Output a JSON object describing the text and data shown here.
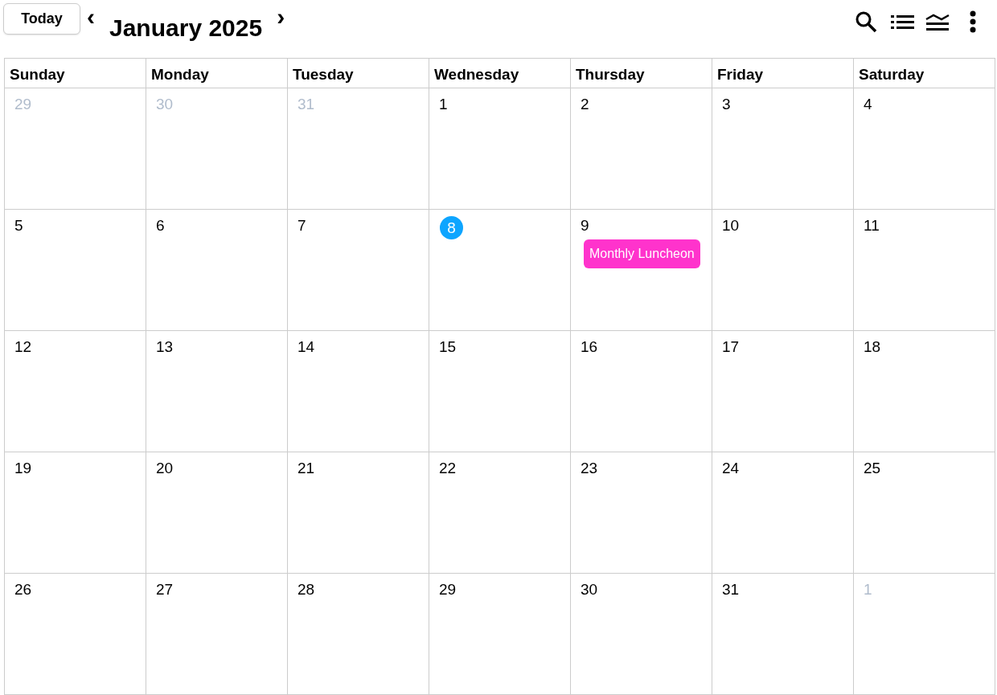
{
  "toolbar": {
    "today_button": "Today",
    "prev": "‹",
    "title": "January 2025",
    "next": "›"
  },
  "weekdays": [
    "Sunday",
    "Monday",
    "Tuesday",
    "Wednesday",
    "Thursday",
    "Friday",
    "Saturday"
  ],
  "weeks": [
    [
      {
        "day": "29",
        "outside": true,
        "today": false
      },
      {
        "day": "30",
        "outside": true,
        "today": false
      },
      {
        "day": "31",
        "outside": true,
        "today": false
      },
      {
        "day": "1",
        "outside": false,
        "today": false
      },
      {
        "day": "2",
        "outside": false,
        "today": false
      },
      {
        "day": "3",
        "outside": false,
        "today": false
      },
      {
        "day": "4",
        "outside": false,
        "today": false
      }
    ],
    [
      {
        "day": "5",
        "outside": false,
        "today": false
      },
      {
        "day": "6",
        "outside": false,
        "today": false
      },
      {
        "day": "7",
        "outside": false,
        "today": false
      },
      {
        "day": "8",
        "outside": false,
        "today": true
      },
      {
        "day": "9",
        "outside": false,
        "today": false,
        "events": [
          {
            "title": "Monthly Luncheon",
            "color": "#ff33cc"
          }
        ]
      },
      {
        "day": "10",
        "outside": false,
        "today": false
      },
      {
        "day": "11",
        "outside": false,
        "today": false
      }
    ],
    [
      {
        "day": "12",
        "outside": false,
        "today": false
      },
      {
        "day": "13",
        "outside": false,
        "today": false
      },
      {
        "day": "14",
        "outside": false,
        "today": false
      },
      {
        "day": "15",
        "outside": false,
        "today": false
      },
      {
        "day": "16",
        "outside": false,
        "today": false
      },
      {
        "day": "17",
        "outside": false,
        "today": false
      },
      {
        "day": "18",
        "outside": false,
        "today": false
      }
    ],
    [
      {
        "day": "19",
        "outside": false,
        "today": false
      },
      {
        "day": "20",
        "outside": false,
        "today": false
      },
      {
        "day": "21",
        "outside": false,
        "today": false
      },
      {
        "day": "22",
        "outside": false,
        "today": false
      },
      {
        "day": "23",
        "outside": false,
        "today": false
      },
      {
        "day": "24",
        "outside": false,
        "today": false
      },
      {
        "day": "25",
        "outside": false,
        "today": false
      }
    ],
    [
      {
        "day": "26",
        "outside": false,
        "today": false
      },
      {
        "day": "27",
        "outside": false,
        "today": false
      },
      {
        "day": "28",
        "outside": false,
        "today": false
      },
      {
        "day": "29",
        "outside": false,
        "today": false
      },
      {
        "day": "30",
        "outside": false,
        "today": false
      },
      {
        "day": "31",
        "outside": false,
        "today": false
      },
      {
        "day": "1",
        "outside": true,
        "today": false
      }
    ]
  ]
}
